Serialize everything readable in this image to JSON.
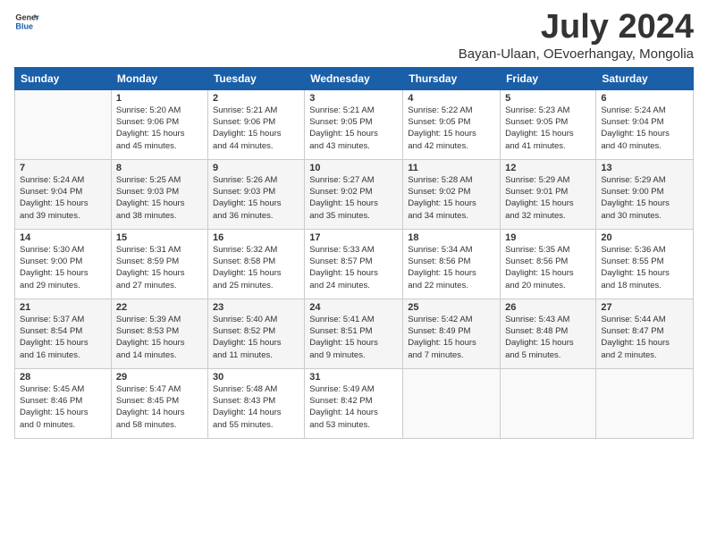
{
  "header": {
    "logo_general": "General",
    "logo_blue": "Blue",
    "month_title": "July 2024",
    "subtitle": "Bayan-Ulaan, OEvoerhangay, Mongolia"
  },
  "weekdays": [
    "Sunday",
    "Monday",
    "Tuesday",
    "Wednesday",
    "Thursday",
    "Friday",
    "Saturday"
  ],
  "weeks": [
    [
      {
        "day": "",
        "sunrise": "",
        "sunset": "",
        "daylight": ""
      },
      {
        "day": "1",
        "sunrise": "Sunrise: 5:20 AM",
        "sunset": "Sunset: 9:06 PM",
        "daylight": "Daylight: 15 hours and 45 minutes."
      },
      {
        "day": "2",
        "sunrise": "Sunrise: 5:21 AM",
        "sunset": "Sunset: 9:06 PM",
        "daylight": "Daylight: 15 hours and 44 minutes."
      },
      {
        "day": "3",
        "sunrise": "Sunrise: 5:21 AM",
        "sunset": "Sunset: 9:05 PM",
        "daylight": "Daylight: 15 hours and 43 minutes."
      },
      {
        "day": "4",
        "sunrise": "Sunrise: 5:22 AM",
        "sunset": "Sunset: 9:05 PM",
        "daylight": "Daylight: 15 hours and 42 minutes."
      },
      {
        "day": "5",
        "sunrise": "Sunrise: 5:23 AM",
        "sunset": "Sunset: 9:05 PM",
        "daylight": "Daylight: 15 hours and 41 minutes."
      },
      {
        "day": "6",
        "sunrise": "Sunrise: 5:24 AM",
        "sunset": "Sunset: 9:04 PM",
        "daylight": "Daylight: 15 hours and 40 minutes."
      }
    ],
    [
      {
        "day": "7",
        "sunrise": "Sunrise: 5:24 AM",
        "sunset": "Sunset: 9:04 PM",
        "daylight": "Daylight: 15 hours and 39 minutes."
      },
      {
        "day": "8",
        "sunrise": "Sunrise: 5:25 AM",
        "sunset": "Sunset: 9:03 PM",
        "daylight": "Daylight: 15 hours and 38 minutes."
      },
      {
        "day": "9",
        "sunrise": "Sunrise: 5:26 AM",
        "sunset": "Sunset: 9:03 PM",
        "daylight": "Daylight: 15 hours and 36 minutes."
      },
      {
        "day": "10",
        "sunrise": "Sunrise: 5:27 AM",
        "sunset": "Sunset: 9:02 PM",
        "daylight": "Daylight: 15 hours and 35 minutes."
      },
      {
        "day": "11",
        "sunrise": "Sunrise: 5:28 AM",
        "sunset": "Sunset: 9:02 PM",
        "daylight": "Daylight: 15 hours and 34 minutes."
      },
      {
        "day": "12",
        "sunrise": "Sunrise: 5:29 AM",
        "sunset": "Sunset: 9:01 PM",
        "daylight": "Daylight: 15 hours and 32 minutes."
      },
      {
        "day": "13",
        "sunrise": "Sunrise: 5:29 AM",
        "sunset": "Sunset: 9:00 PM",
        "daylight": "Daylight: 15 hours and 30 minutes."
      }
    ],
    [
      {
        "day": "14",
        "sunrise": "Sunrise: 5:30 AM",
        "sunset": "Sunset: 9:00 PM",
        "daylight": "Daylight: 15 hours and 29 minutes."
      },
      {
        "day": "15",
        "sunrise": "Sunrise: 5:31 AM",
        "sunset": "Sunset: 8:59 PM",
        "daylight": "Daylight: 15 hours and 27 minutes."
      },
      {
        "day": "16",
        "sunrise": "Sunrise: 5:32 AM",
        "sunset": "Sunset: 8:58 PM",
        "daylight": "Daylight: 15 hours and 25 minutes."
      },
      {
        "day": "17",
        "sunrise": "Sunrise: 5:33 AM",
        "sunset": "Sunset: 8:57 PM",
        "daylight": "Daylight: 15 hours and 24 minutes."
      },
      {
        "day": "18",
        "sunrise": "Sunrise: 5:34 AM",
        "sunset": "Sunset: 8:56 PM",
        "daylight": "Daylight: 15 hours and 22 minutes."
      },
      {
        "day": "19",
        "sunrise": "Sunrise: 5:35 AM",
        "sunset": "Sunset: 8:56 PM",
        "daylight": "Daylight: 15 hours and 20 minutes."
      },
      {
        "day": "20",
        "sunrise": "Sunrise: 5:36 AM",
        "sunset": "Sunset: 8:55 PM",
        "daylight": "Daylight: 15 hours and 18 minutes."
      }
    ],
    [
      {
        "day": "21",
        "sunrise": "Sunrise: 5:37 AM",
        "sunset": "Sunset: 8:54 PM",
        "daylight": "Daylight: 15 hours and 16 minutes."
      },
      {
        "day": "22",
        "sunrise": "Sunrise: 5:39 AM",
        "sunset": "Sunset: 8:53 PM",
        "daylight": "Daylight: 15 hours and 14 minutes."
      },
      {
        "day": "23",
        "sunrise": "Sunrise: 5:40 AM",
        "sunset": "Sunset: 8:52 PM",
        "daylight": "Daylight: 15 hours and 11 minutes."
      },
      {
        "day": "24",
        "sunrise": "Sunrise: 5:41 AM",
        "sunset": "Sunset: 8:51 PM",
        "daylight": "Daylight: 15 hours and 9 minutes."
      },
      {
        "day": "25",
        "sunrise": "Sunrise: 5:42 AM",
        "sunset": "Sunset: 8:49 PM",
        "daylight": "Daylight: 15 hours and 7 minutes."
      },
      {
        "day": "26",
        "sunrise": "Sunrise: 5:43 AM",
        "sunset": "Sunset: 8:48 PM",
        "daylight": "Daylight: 15 hours and 5 minutes."
      },
      {
        "day": "27",
        "sunrise": "Sunrise: 5:44 AM",
        "sunset": "Sunset: 8:47 PM",
        "daylight": "Daylight: 15 hours and 2 minutes."
      }
    ],
    [
      {
        "day": "28",
        "sunrise": "Sunrise: 5:45 AM",
        "sunset": "Sunset: 8:46 PM",
        "daylight": "Daylight: 15 hours and 0 minutes."
      },
      {
        "day": "29",
        "sunrise": "Sunrise: 5:47 AM",
        "sunset": "Sunset: 8:45 PM",
        "daylight": "Daylight: 14 hours and 58 minutes."
      },
      {
        "day": "30",
        "sunrise": "Sunrise: 5:48 AM",
        "sunset": "Sunset: 8:43 PM",
        "daylight": "Daylight: 14 hours and 55 minutes."
      },
      {
        "day": "31",
        "sunrise": "Sunrise: 5:49 AM",
        "sunset": "Sunset: 8:42 PM",
        "daylight": "Daylight: 14 hours and 53 minutes."
      },
      {
        "day": "",
        "sunrise": "",
        "sunset": "",
        "daylight": ""
      },
      {
        "day": "",
        "sunrise": "",
        "sunset": "",
        "daylight": ""
      },
      {
        "day": "",
        "sunrise": "",
        "sunset": "",
        "daylight": ""
      }
    ]
  ]
}
